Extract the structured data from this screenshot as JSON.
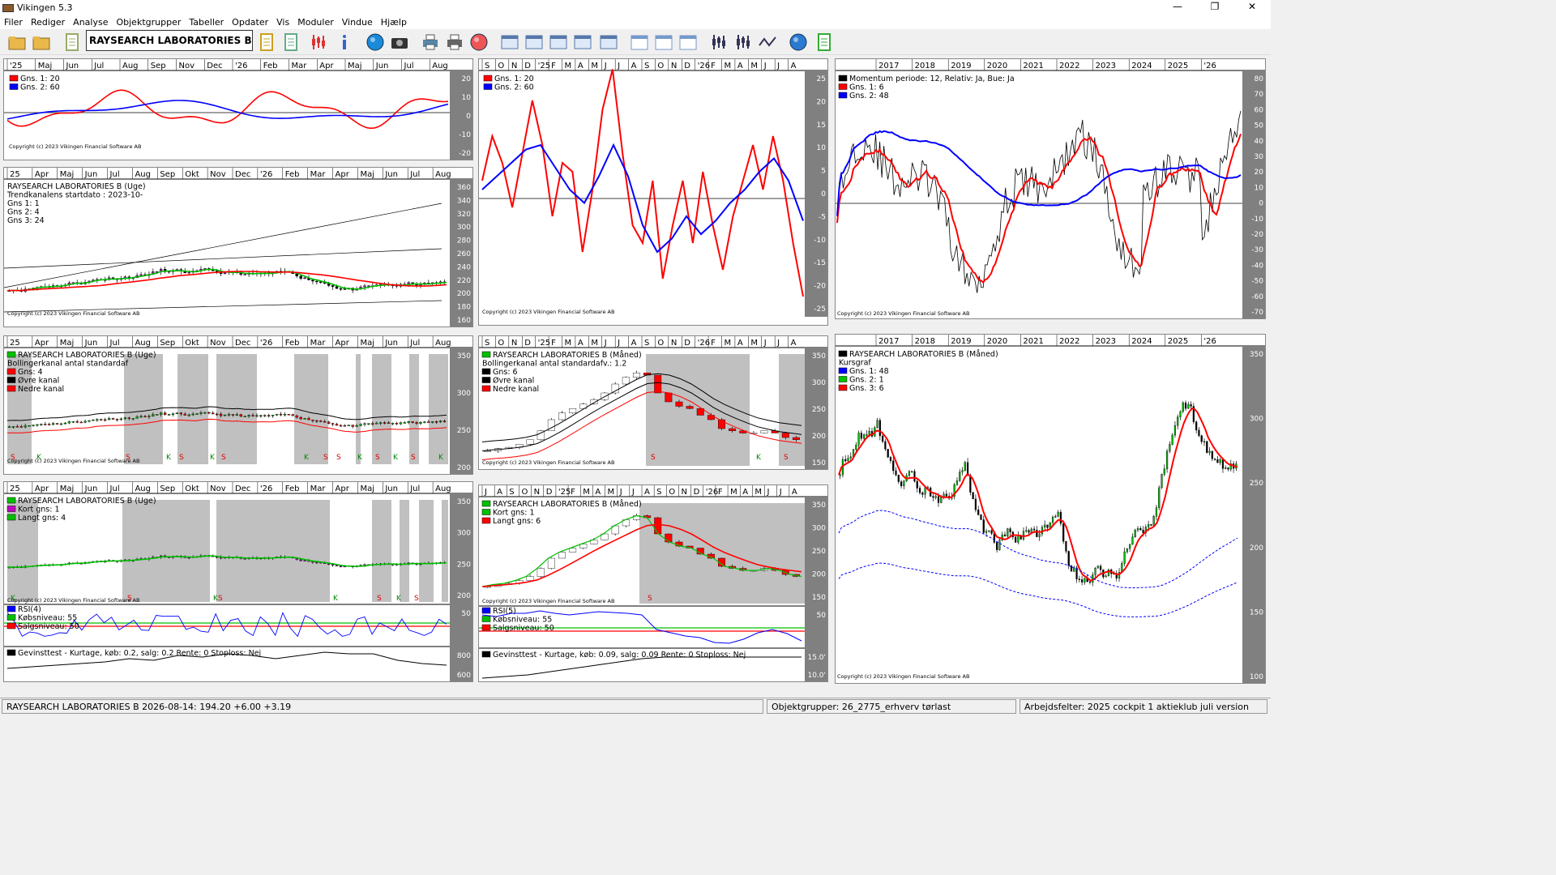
{
  "window": {
    "title": "Vikingen 5.3",
    "minimize": "—",
    "maximize": "❐",
    "close": "✕"
  },
  "menu": [
    "Filer",
    "Rediger",
    "Analyse",
    "Objektgrupper",
    "Tabeller",
    "Opdater",
    "Vis",
    "Moduler",
    "Vindue",
    "Hjælp"
  ],
  "toolbar": {
    "instrument": "RAYSEARCH LABORATORIES B"
  },
  "copyright": "Copyright (c) 2023 Vikingen Financial Software AB",
  "status": {
    "quote": "RAYSEARCH LABORATORIES B 2026-08-14:  194.20   +6.00    +3.19",
    "group": "Objektgrupper: 26_2775_erhverv tørlast",
    "workspace": "Arbejdsfelter: 2025 cockpit 1 aktieklub juli version"
  },
  "axes": {
    "weekly_months_a": [
      "'25",
      "Maj",
      "Jun",
      "Jul",
      "Aug",
      "Sep",
      "Nov",
      "Dec",
      "'26",
      "Feb",
      "Mar",
      "Apr",
      "Maj",
      "Jun",
      "Jul",
      "Aug"
    ],
    "weekly_months_b": [
      "25",
      "Apr",
      "Maj",
      "Jun",
      "Jul",
      "Aug",
      "Sep",
      "Okt",
      "Nov",
      "Dec",
      "'26",
      "Feb",
      "Mar",
      "Apr",
      "Maj",
      "Jun",
      "Jul",
      "Aug"
    ],
    "monthly_letters_a": [
      "S",
      "O",
      "N",
      "D",
      "'25",
      "F",
      "M",
      "A",
      "M",
      "J",
      "J",
      "A",
      "S",
      "O",
      "N",
      "D",
      "'26",
      "F",
      "M",
      "A",
      "M",
      "J",
      "J",
      "A"
    ],
    "monthly_letters_b": [
      "J",
      "A",
      "S",
      "O",
      "N",
      "D",
      "'25",
      "F",
      "M",
      "A",
      "M",
      "J",
      "J",
      "A",
      "S",
      "O",
      "N",
      "D",
      "'26",
      "F",
      "M",
      "A",
      "M",
      "J",
      "J",
      "A"
    ],
    "years": [
      "2017",
      "2018",
      "2019",
      "2020",
      "2021",
      "2022",
      "2023",
      "2024",
      "2025",
      "'26"
    ]
  },
  "panels": {
    "p1": {
      "legend": [
        "Gns. 1: 20",
        "Gns. 2: 60"
      ],
      "yticks": [
        "20",
        "10",
        "0",
        "-10",
        "-20"
      ]
    },
    "p2": {
      "legend": [
        "RAYSEARCH LABORATORIES B (Uge)",
        "Trendkanalens startdato : 2023-10-",
        "Gns 1: 1",
        "Gns 2: 4",
        "Gns 3: 24"
      ],
      "yticks": [
        "360",
        "340",
        "320",
        "300",
        "280",
        "260",
        "240",
        "220",
        "200",
        "180",
        "160"
      ]
    },
    "p3": {
      "legend": [
        "Gns. 1: 20",
        "Gns. 2: 60"
      ],
      "yticks": [
        "25",
        "20",
        "15",
        "10",
        "5",
        "0",
        "-5",
        "-10",
        "-15",
        "-20",
        "-25"
      ]
    },
    "p4": {
      "legend": [
        "Momentum periode: 12, Relativ: Ja, Bue: Ja",
        "Gns. 1: 6",
        "Gns. 2: 48"
      ],
      "yticks": [
        "80",
        "70",
        "60",
        "50",
        "40",
        "30",
        "20",
        "10",
        "0",
        "-10",
        "-20",
        "-30",
        "-40",
        "-50",
        "-60",
        "-70"
      ]
    },
    "p5": {
      "legend": [
        "RAYSEARCH LABORATORIES B (Uge)",
        "Bollingerkanal antal standardaf",
        "Gns: 4",
        "Øvre kanal",
        "Nedre kanal"
      ],
      "yticks": [
        "350",
        "300",
        "250",
        "200"
      ],
      "signals": [
        "S",
        "K",
        "S",
        "K",
        "S",
        "K",
        "S",
        "K",
        "S",
        "S",
        "K",
        "S",
        "K",
        "S",
        "K"
      ]
    },
    "p6": {
      "legend": [
        "RAYSEARCH LABORATORIES B (Måned)",
        "Bollingerkanal antal standardafv.: 1.2",
        "Gns: 6",
        "Øvre kanal",
        "Nedre kanal"
      ],
      "yticks": [
        "350",
        "300",
        "250",
        "200",
        "150"
      ],
      "signals": [
        "S",
        "K",
        "S"
      ]
    },
    "p7": {
      "legend": [
        "RAYSEARCH LABORATORIES B (Uge)",
        "Kort gns: 1",
        "Langt gns: 4"
      ],
      "yticks": [
        "350",
        "300",
        "250",
        "200"
      ],
      "signals": [
        "K",
        "S",
        "K",
        "S",
        "K",
        "S",
        "K",
        "S"
      ],
      "rsi": [
        "RSI(4)",
        "Købsniveau: 55",
        "Salgsniveau: 50"
      ],
      "rsi_tick": "50",
      "gain": "Gevinsttest - Kurtage, køb: 0.2, salg: 0.2 Rente: 0 Stoploss: Nej",
      "gain_ticks": [
        "800",
        "600"
      ]
    },
    "p8": {
      "legend": [
        "RAYSEARCH LABORATORIES B (Måned)",
        "Kort gns: 1",
        "Langt gns: 6"
      ],
      "yticks": [
        "350",
        "300",
        "250",
        "200",
        "150"
      ],
      "signals": [
        "S"
      ],
      "rsi": [
        "RSI(5)",
        "Købsniveau: 55",
        "Salgsniveau: 50"
      ],
      "rsi_tick": "50",
      "gain": "Gevinsttest - Kurtage, køb: 0.09, salg: 0.09 Rente: 0 Stoploss: Nej",
      "gain_ticks": [
        "15.0'",
        "10.0'"
      ]
    },
    "p9": {
      "legend": [
        "RAYSEARCH LABORATORIES B (Måned)",
        "Kursgraf",
        "Gns. 1: 48",
        "Gns. 2: 1",
        "Gns. 3: 6"
      ],
      "yticks": [
        "350",
        "300",
        "250",
        "200",
        "150",
        "100"
      ]
    }
  },
  "colors": {
    "red": "#ff0000",
    "blue": "#0000ff",
    "green": "#00c000",
    "magenta": "#c000c0",
    "grey_axis": "#808080",
    "band": "#c0c0c0"
  }
}
